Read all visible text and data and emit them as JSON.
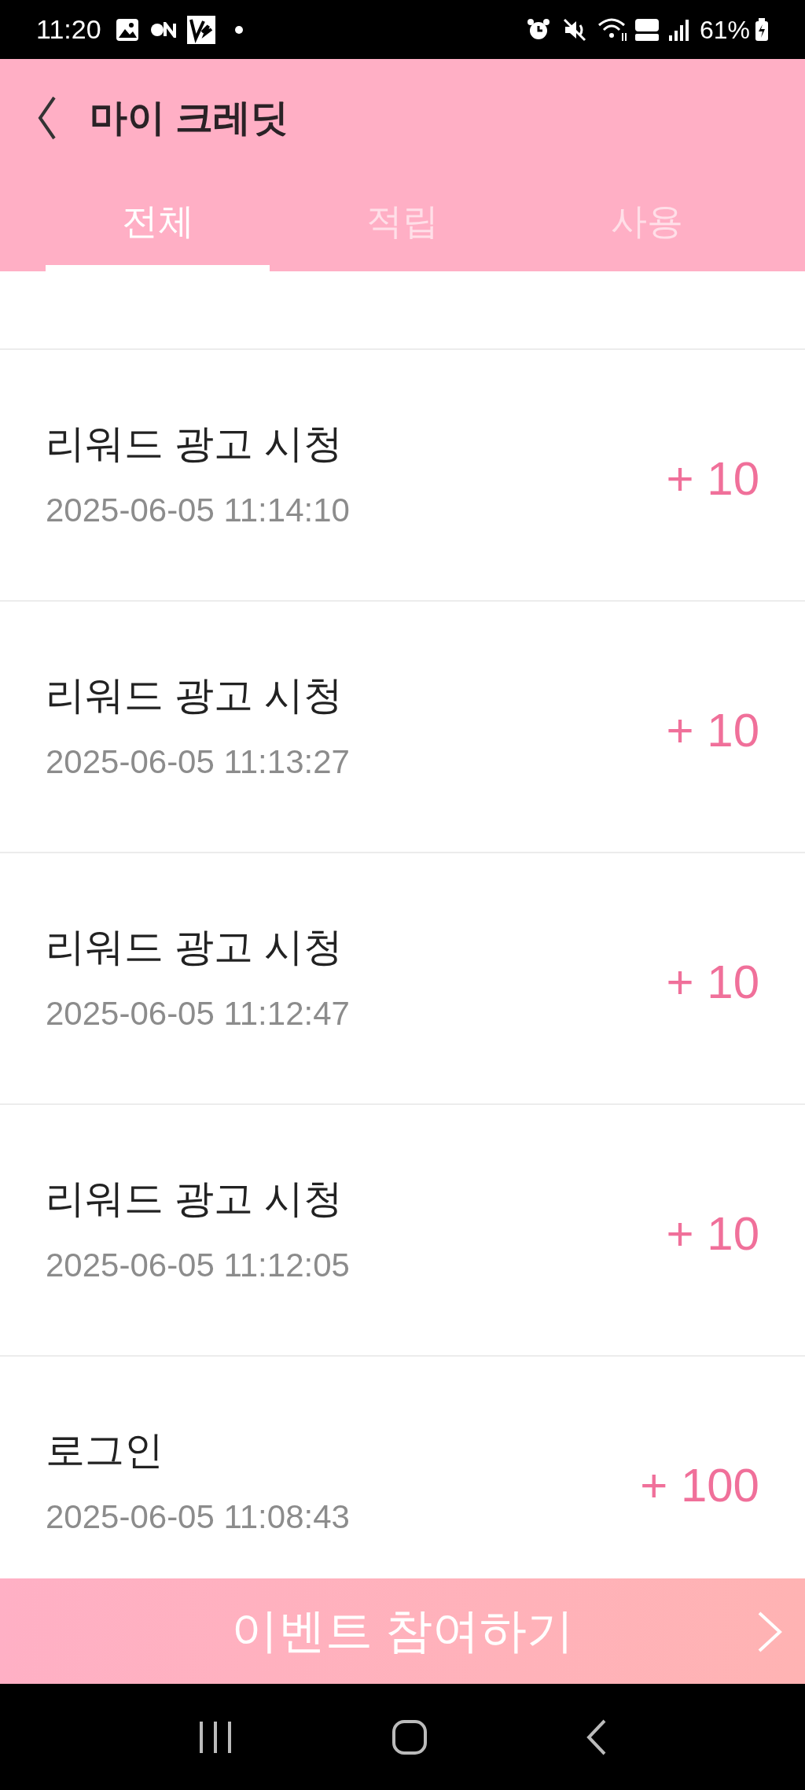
{
  "status_bar": {
    "time": "11:20",
    "battery": "61%"
  },
  "header": {
    "title": "마이 크레딧"
  },
  "tabs": [
    {
      "label": "전체",
      "selected": true
    },
    {
      "label": "적립",
      "selected": false
    },
    {
      "label": "사용",
      "selected": false
    }
  ],
  "rows": [
    {
      "title": "리워드 광고 시청",
      "date": "2025-06-05 11:14:10",
      "amount": "+ 10"
    },
    {
      "title": "리워드 광고 시청",
      "date": "2025-06-05 11:13:27",
      "amount": "+ 10"
    },
    {
      "title": "리워드 광고 시청",
      "date": "2025-06-05 11:12:47",
      "amount": "+ 10"
    },
    {
      "title": "리워드 광고 시청",
      "date": "2025-06-05 11:12:05",
      "amount": "+ 10"
    },
    {
      "title": "로그인",
      "date": "2025-06-05 11:08:43",
      "amount": "+ 100"
    }
  ],
  "event_button": {
    "label": "이벤트 참여하기"
  }
}
